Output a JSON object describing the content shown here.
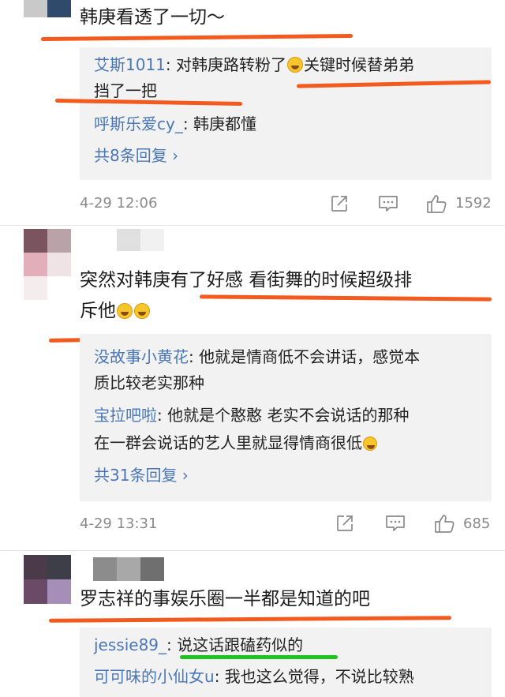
{
  "comment1": {
    "text": "韩庚看透了一切～",
    "replies": [
      {
        "user": "艾斯1011",
        "sep": ": ",
        "text_a": "对韩庚路转粉了",
        "text_b": "关键时候替弟弟",
        "text_c": "挡了一把"
      },
      {
        "user": "呼斯乐爱cy_",
        "sep": ": ",
        "text": "韩庚都懂"
      }
    ],
    "more": "共8条回复 ›",
    "time": "4-29 12:06",
    "likes": "1592"
  },
  "comment2": {
    "text_line1": "突然对韩庚有了好感 看街舞的时候超级排",
    "text_line2": "斥他",
    "replies": [
      {
        "user": "没故事小黄花",
        "sep": ": ",
        "text_line1": "他就是情商低不会讲话，感觉本",
        "text_line2": "质比较老实那种"
      },
      {
        "user": "宝拉吧啦",
        "sep": ": ",
        "text_line1": "他就是个憨憨 老实不会说话的那种",
        "text_line2": "在一群会说话的艺人里就显得情商很低"
      }
    ],
    "more": "共31条回复 ›",
    "time": "4-29 13:31",
    "likes": "685"
  },
  "comment3": {
    "text": "罗志祥的事娱乐圈一半都是知道的吧",
    "replies": [
      {
        "user": "jessie89_",
        "sep": ": ",
        "text": "说这话跟磕药似的"
      },
      {
        "user": "可可味的小仙女u",
        "sep": ": ",
        "text": "我也这么觉得，不说比较熟"
      }
    ]
  },
  "icons": [
    "share-icon",
    "comment-icon",
    "like-icon",
    "laugh-cry-emoji"
  ],
  "colors": {
    "link": "#4a77b5",
    "highlight_red": "#f25a1e",
    "highlight_green": "#1fc31f",
    "reply_bg": "#f2f2f2",
    "meta_gray": "#8a8a8a"
  }
}
